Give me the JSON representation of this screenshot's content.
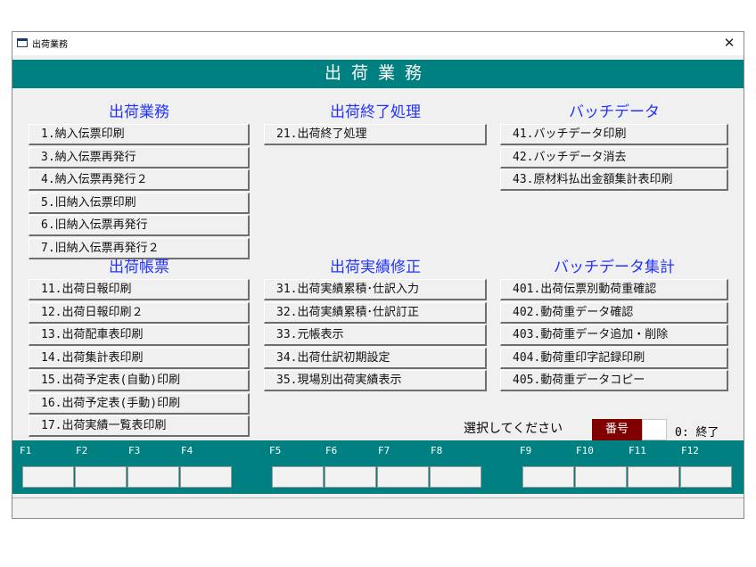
{
  "window": {
    "title": "出荷業務",
    "close_symbol": "✕"
  },
  "banner": "出荷業務",
  "groups": [
    {
      "title": "出荷業務",
      "buttons": [
        "1.納入伝票印刷",
        "3.納入伝票再発行",
        "4.納入伝票再発行２",
        "5.旧納入伝票印刷",
        "6.旧納入伝票再発行",
        "7.旧納入伝票再発行２"
      ]
    },
    {
      "title": "出荷終了処理",
      "buttons": [
        "21.出荷終了処理"
      ]
    },
    {
      "title": "バッチデータ",
      "buttons": [
        "41.バッチデータ印刷",
        "42.バッチデータ消去",
        "43.原材料払出金額集計表印刷"
      ]
    },
    {
      "title": "出荷帳票",
      "buttons": [
        "11.出荷日報印刷",
        "12.出荷日報印刷２",
        "13.出荷配車表印刷",
        "14.出荷集計表印刷",
        "15.出荷予定表(自動)印刷",
        "16.出荷予定表(手動)印刷",
        "17.出荷実績一覧表印刷"
      ]
    },
    {
      "title": "出荷実績修正",
      "buttons": [
        "31.出荷実績累積･仕訳入力",
        "32.出荷実績累積･仕訳訂正",
        "33.元帳表示",
        "34.出荷仕訳初期設定",
        "35.現場別出荷実績表示"
      ]
    },
    {
      "title": "バッチデータ集計",
      "buttons": [
        "401.出荷伝票別動荷重確認",
        "402.動荷重データ確認",
        "403.動荷重データ追加・削除",
        "404.動荷重印字記録印刷",
        "405.動荷重データコピー"
      ]
    }
  ],
  "selection": {
    "prompt": "選択してください",
    "number_label": "番号",
    "number_value": "",
    "exit_hint": "0: 終了"
  },
  "fkeys": [
    "F1",
    "F2",
    "F3",
    "F4",
    "F5",
    "F6",
    "F7",
    "F8",
    "F9",
    "F10",
    "F11",
    "F12"
  ],
  "colors": {
    "teal": "#008080",
    "group_title": "#2233ff",
    "number_label_bg": "#800000"
  }
}
